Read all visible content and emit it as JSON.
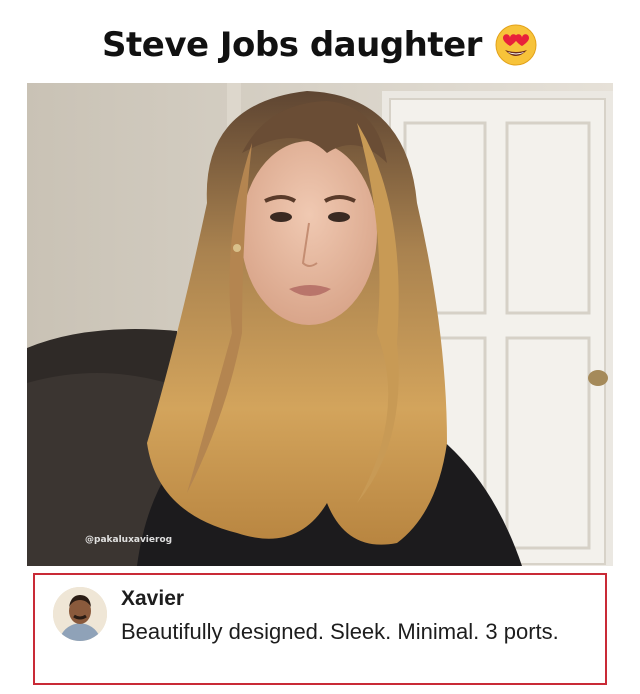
{
  "post": {
    "title": "Steve Jobs daughter",
    "title_emoji": "heart-eyes-emoji"
  },
  "photo": {
    "watermark": "@pakaluxavierog"
  },
  "comment": {
    "author": "Xavier",
    "text": "Beautifully designed. Sleek. Minimal. 3 ports.",
    "border_color": "#c92a36"
  }
}
